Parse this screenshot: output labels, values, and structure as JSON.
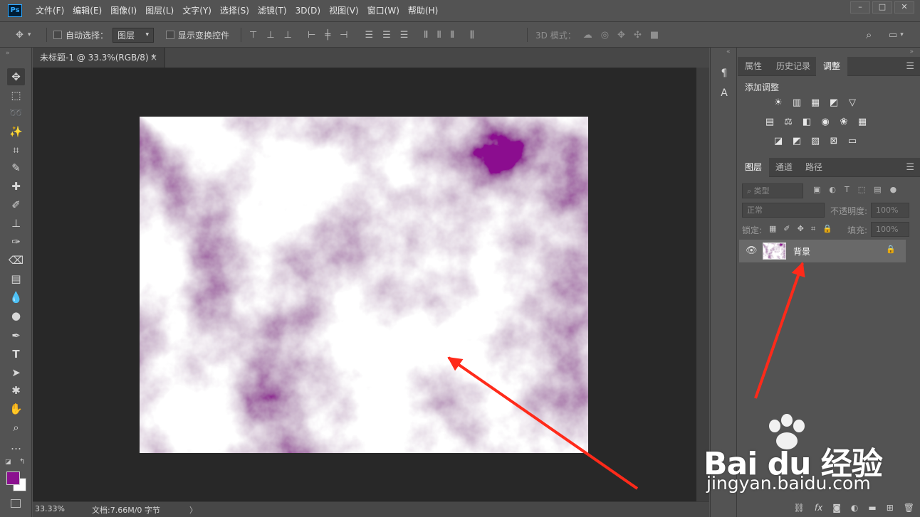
{
  "app": {
    "logo": "Ps"
  },
  "menu": [
    "文件(F)",
    "编辑(E)",
    "图像(I)",
    "图层(L)",
    "文字(Y)",
    "选择(S)",
    "滤镜(T)",
    "3D(D)",
    "视图(V)",
    "窗口(W)",
    "帮助(H)"
  ],
  "window_controls": {
    "minimize": "–",
    "restore": "□",
    "close": "✕"
  },
  "options": {
    "auto_select_label": "自动选择：",
    "auto_select_value": "图层",
    "show_transform_label": "显示变换控件",
    "mode_3d_label": "3D 模式："
  },
  "document": {
    "tab_title": "未标题-1 @ 33.3%(RGB/8) *",
    "tab_close": "×",
    "zoom": "33.33%",
    "doc_info": "文档:7.66M/0 字节",
    "status_arrow": "〉"
  },
  "tool_colors": {
    "foreground": "#8b118f",
    "background": "#ffffff"
  },
  "top_panel": {
    "tabs": [
      "属性",
      "历史记录",
      "调整"
    ],
    "active_tab": "调整",
    "add_adjustment_label": "添加调整"
  },
  "layers_panel": {
    "tabs": [
      "图层",
      "通道",
      "路径"
    ],
    "active_tab": "图层",
    "filter_placeholder": "类型",
    "blend_mode": "正常",
    "opacity_label": "不透明度:",
    "opacity_value": "100%",
    "lock_label": "锁定:",
    "fill_label": "填充:",
    "fill_value": "100%",
    "layers": [
      {
        "name": "背景",
        "visible": true,
        "locked": true
      }
    ]
  },
  "annotations": {
    "arrow_color": "#ff2a1a"
  },
  "watermark": {
    "site": "jingyan.baidu.com",
    "logo_text": "Bai du 经验"
  }
}
